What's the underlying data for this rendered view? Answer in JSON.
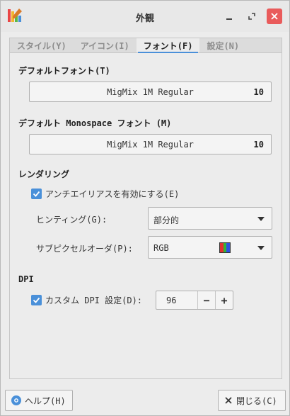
{
  "window": {
    "title": "外観"
  },
  "tabs": [
    {
      "label": "スタイル(Y)",
      "active": false
    },
    {
      "label": "アイコン(I)",
      "active": false
    },
    {
      "label": "フォント(F)",
      "active": true
    },
    {
      "label": "設定(N)",
      "active": false
    }
  ],
  "default_font": {
    "heading": "デフォルトフォント(T)",
    "name": "MigMix 1M Regular",
    "size": "10"
  },
  "mono_font": {
    "heading": "デフォルト Monospace フォント (M)",
    "name": "MigMix 1M Regular",
    "size": "10"
  },
  "rendering": {
    "heading": "レンダリング",
    "antialias_label": "アンチエイリアスを有効にする(E)",
    "antialias_checked": true,
    "hinting_label": "ヒンティング(G):",
    "hinting_value": "部分的",
    "subpixel_label": "サブピクセルオーダ(P):",
    "subpixel_value": "RGB"
  },
  "dpi": {
    "heading": "DPI",
    "custom_label": "カスタム DPI 設定(D):",
    "custom_checked": true,
    "value": "96",
    "minus": "−",
    "plus": "+"
  },
  "buttons": {
    "help_label": "ヘルプ(H)",
    "close_label": "閉じる(C)"
  },
  "colors": {
    "accent": "#4a90d9",
    "close_button": "#e95b5b"
  }
}
